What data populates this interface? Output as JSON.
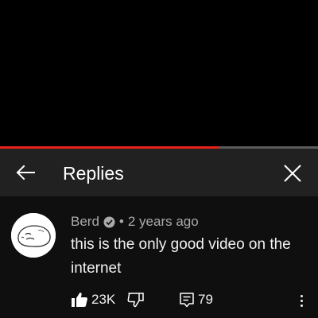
{
  "player": {
    "progress_fraction": 0.69,
    "colors": {
      "played": "#e62117",
      "track": "#5a5a5a"
    }
  },
  "header": {
    "title": "Replies",
    "back_icon": "arrow-left-icon",
    "close_icon": "close-icon"
  },
  "comment": {
    "author": "Berd",
    "verified_icon": "verified-check-icon",
    "separator": "•",
    "timestamp": "2 years ago",
    "text": "this is the only good video on the internet",
    "likes": "23K",
    "replies": "79",
    "icons": {
      "like": "thumbs-up-filled-icon",
      "dislike": "thumbs-down-icon",
      "reply": "reply-comment-icon",
      "more": "more-vertical-icon"
    }
  }
}
